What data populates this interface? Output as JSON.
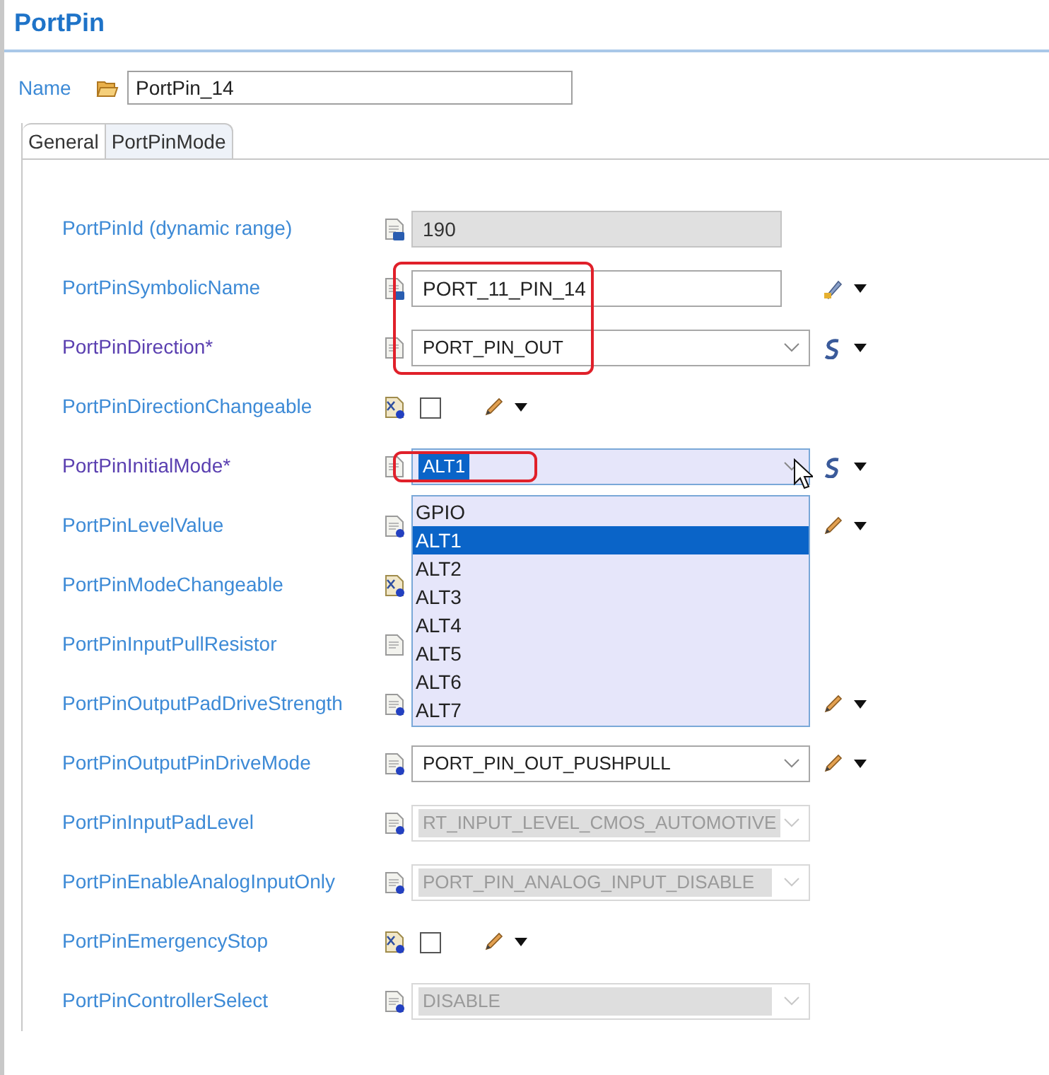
{
  "title": "PortPin",
  "name_field": {
    "label": "Name",
    "value": "PortPin_14"
  },
  "tabs": [
    {
      "label": "General",
      "selected": true
    },
    {
      "label": "PortPinMode",
      "selected": false
    }
  ],
  "rows": [
    {
      "label": "PortPinId (dynamic range)",
      "mandatory": false,
      "param_icon": {
        "kind": "calc"
      },
      "kind": "text",
      "value": "190",
      "disabled": true,
      "highlight": false
    },
    {
      "label": "PortPinSymbolicName",
      "mandatory": false,
      "param_icon": {
        "kind": "calc"
      },
      "kind": "text",
      "value": "PORT_11_PIN_14",
      "disabled": false,
      "editor": {
        "kind": "wand"
      },
      "highlight": true
    },
    {
      "label": "PortPinDirection*",
      "mandatory": true,
      "param_icon": {
        "kind": "plain"
      },
      "kind": "combo",
      "value": "PORT_PIN_OUT",
      "disabled": false,
      "editor": {
        "kind": "swirl"
      },
      "highlight": true
    },
    {
      "label": "PortPinDirectionChangeable",
      "mandatory": false,
      "param_icon": {
        "kind": "boolean"
      },
      "kind": "checkbox",
      "checked": false,
      "editor": {
        "kind": "pencil"
      },
      "highlight": false
    },
    {
      "label": "PortPinInitialMode*",
      "mandatory": true,
      "param_icon": {
        "kind": "plain"
      },
      "kind": "combo",
      "value": "ALT1",
      "disabled": false,
      "editor": {
        "kind": "swirl"
      },
      "highlight": true,
      "expanded": true,
      "options": [
        {
          "label": "GPIO",
          "selected": false
        },
        {
          "label": "ALT1",
          "selected": true
        },
        {
          "label": "ALT2",
          "selected": false
        },
        {
          "label": "ALT3",
          "selected": false
        },
        {
          "label": "ALT4",
          "selected": false
        },
        {
          "label": "ALT5",
          "selected": false
        },
        {
          "label": "ALT6",
          "selected": false
        },
        {
          "label": "ALT7",
          "selected": false
        }
      ]
    },
    {
      "label": "PortPinLevelValue",
      "mandatory": false,
      "param_icon": {
        "kind": "default"
      },
      "kind": "covered",
      "editor": {
        "kind": "pencil"
      },
      "highlight": false
    },
    {
      "label": "PortPinModeChangeable",
      "mandatory": false,
      "param_icon": {
        "kind": "boolean"
      },
      "kind": "covered",
      "highlight": false
    },
    {
      "label": "PortPinInputPullResistor",
      "mandatory": false,
      "param_icon": {
        "kind": "plain"
      },
      "kind": "covered",
      "highlight": false
    },
    {
      "label": "PortPinOutputPadDriveStrength",
      "mandatory": false,
      "param_icon": {
        "kind": "default"
      },
      "kind": "covered",
      "editor": {
        "kind": "pencil"
      },
      "highlight": false
    },
    {
      "label": "PortPinOutputPinDriveMode",
      "mandatory": false,
      "param_icon": {
        "kind": "default"
      },
      "kind": "combo",
      "value": "PORT_PIN_OUT_PUSHPULL",
      "disabled": false,
      "editor": {
        "kind": "pencil"
      },
      "highlight": false
    },
    {
      "label": "PortPinInputPadLevel",
      "mandatory": false,
      "param_icon": {
        "kind": "default"
      },
      "kind": "combo",
      "value": "RT_INPUT_LEVEL_CMOS_AUTOMOTIVE",
      "disabled": true,
      "highlight": false
    },
    {
      "label": "PortPinEnableAnalogInputOnly",
      "mandatory": false,
      "param_icon": {
        "kind": "default"
      },
      "kind": "combo",
      "value": "PORT_PIN_ANALOG_INPUT_DISABLE",
      "disabled": true,
      "highlight": false
    },
    {
      "label": "PortPinEmergencyStop",
      "mandatory": false,
      "param_icon": {
        "kind": "boolean"
      },
      "kind": "checkbox",
      "checked": false,
      "editor": {
        "kind": "pencil"
      },
      "highlight": false
    },
    {
      "label": "PortPinControllerSelect",
      "mandatory": false,
      "param_icon": {
        "kind": "default"
      },
      "kind": "combo",
      "value": "DISABLE",
      "disabled": true,
      "highlight": false
    }
  ]
}
